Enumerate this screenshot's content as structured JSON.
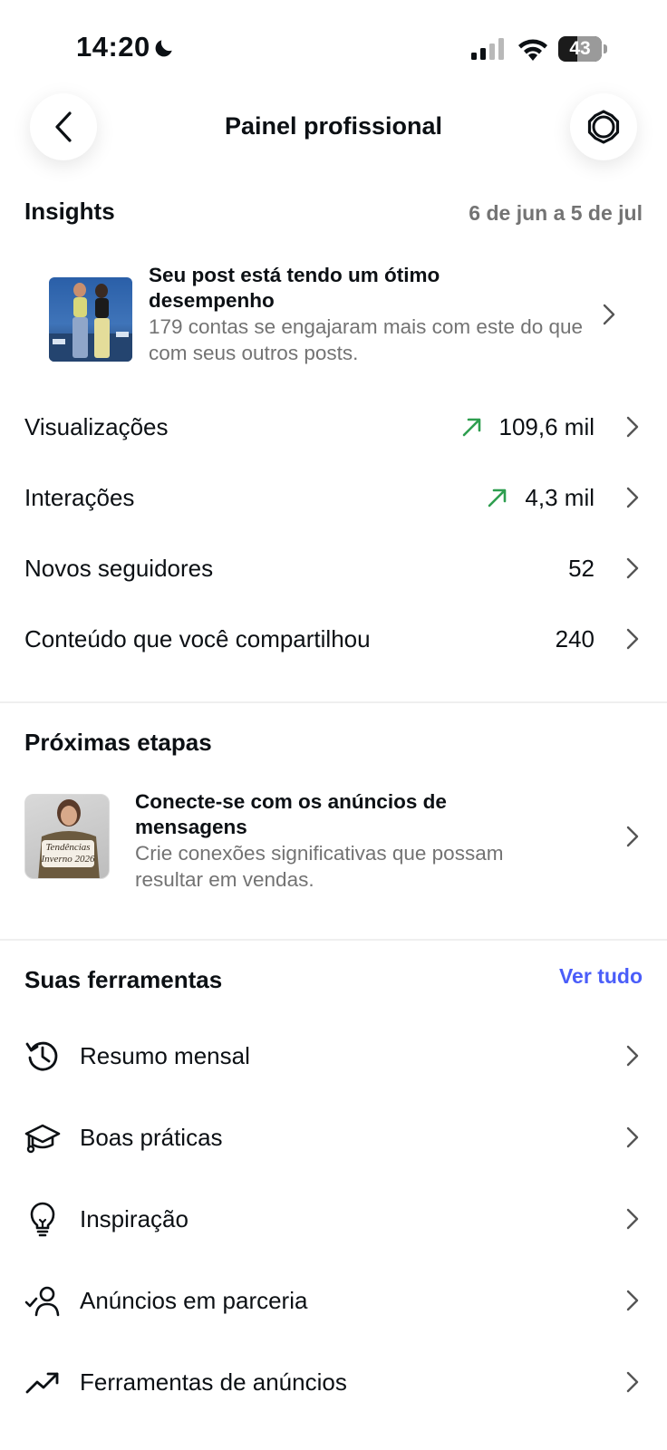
{
  "status_bar": {
    "time": "14:20",
    "battery": "43",
    "battery_level": 0.43
  },
  "header": {
    "title": "Painel profissional"
  },
  "insights": {
    "title": "Insights",
    "date_range": "6 de jun a 5 de jul",
    "highlight": {
      "title": "Seu post está tendo um ótimo desempenho",
      "description": "179 contas se engajaram mais com este do que com seus outros posts."
    },
    "metrics": [
      {
        "label": "Visualizações",
        "value": "109,6 mil",
        "trend": "up"
      },
      {
        "label": "Interações",
        "value": "4,3 mil",
        "trend": "up"
      },
      {
        "label": "Novos seguidores",
        "value": "52"
      },
      {
        "label": "Conteúdo que você compartilhou",
        "value": "240"
      }
    ]
  },
  "next_steps": {
    "title": "Próximas etapas",
    "card": {
      "title": "Conecte-se com os anúncios de mensagens",
      "description": "Crie conexões significativas que possam resultar em vendas.",
      "thumb_text": "Tendências Inverno 2026"
    }
  },
  "tools": {
    "title": "Suas ferramentas",
    "see_all": "Ver tudo",
    "items": [
      {
        "label": "Resumo mensal",
        "icon": "history-icon"
      },
      {
        "label": "Boas práticas",
        "icon": "graduation-cap-icon"
      },
      {
        "label": "Inspiração",
        "icon": "lightbulb-icon"
      },
      {
        "label": "Anúncios em parceria",
        "icon": "user-check-icon"
      },
      {
        "label": "Ferramentas de anúncios",
        "icon": "trending-up-icon"
      }
    ]
  },
  "colors": {
    "accent": "#4a5df9",
    "trend_up": "#2e9e4f",
    "secondary_text": "#737373"
  }
}
